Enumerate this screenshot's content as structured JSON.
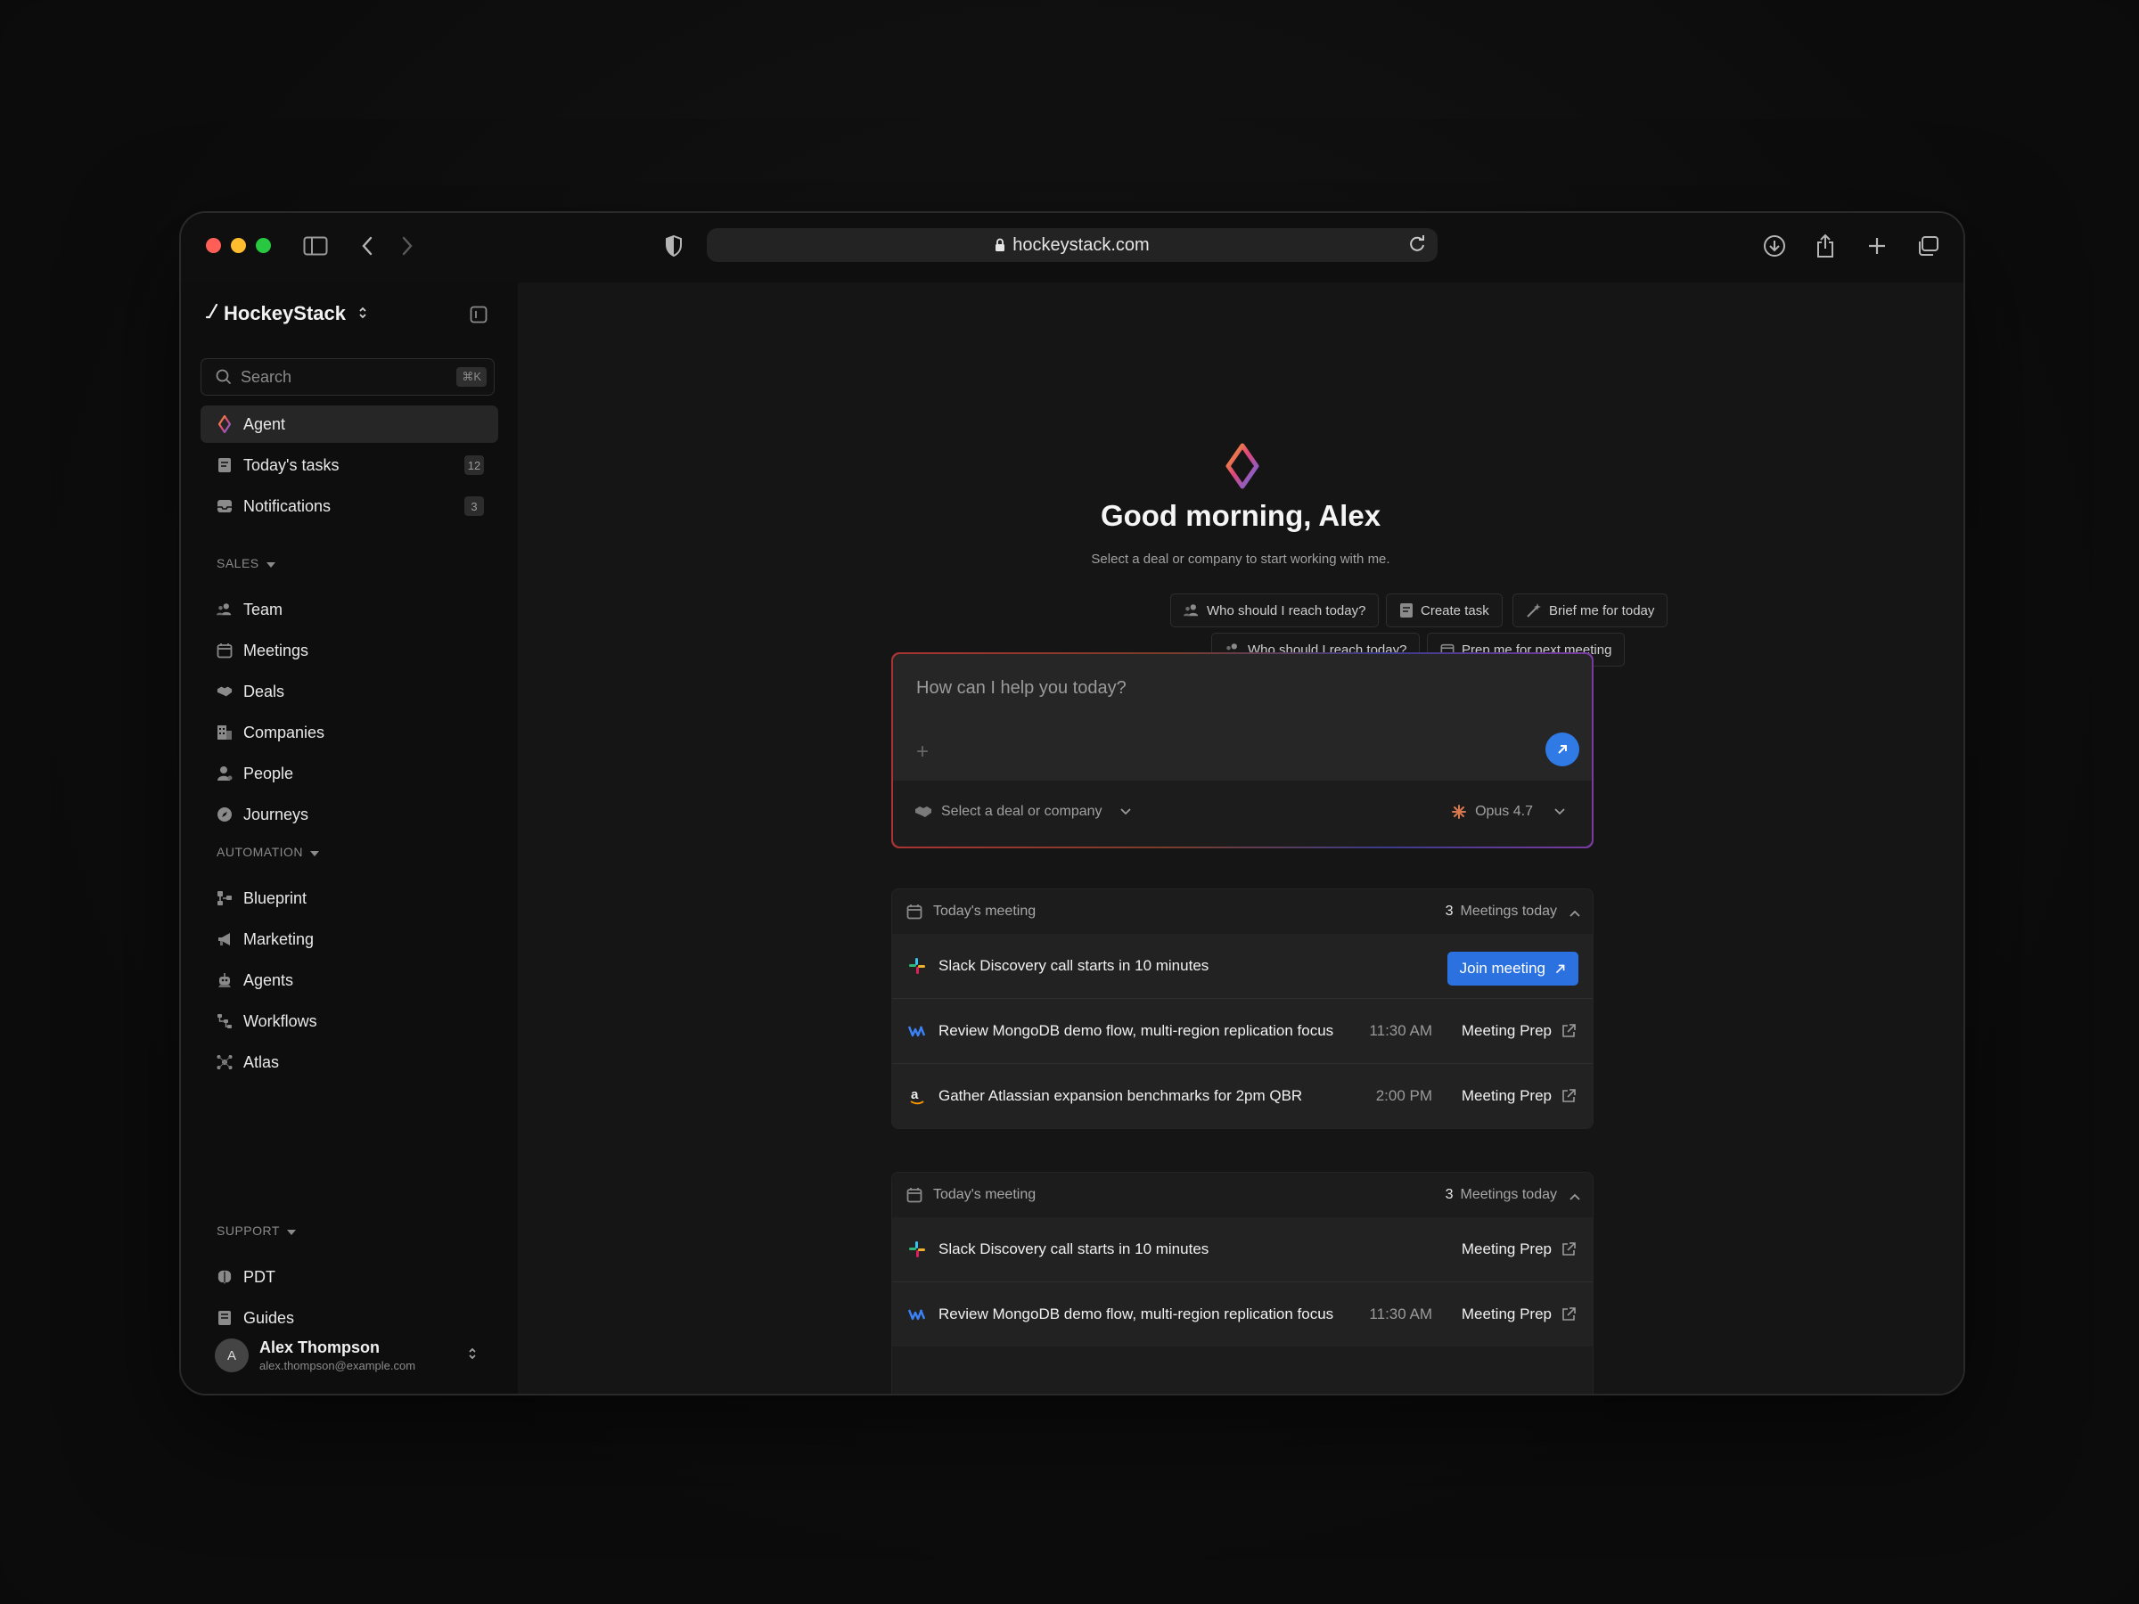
{
  "browser": {
    "url": "hockeystack.com"
  },
  "sidebar": {
    "brand": "HockeyStack",
    "search": {
      "placeholder": "Search",
      "shortcut": "⌘K"
    },
    "top_items": [
      {
        "label": "Agent",
        "icon": "agent-icon",
        "active": true
      },
      {
        "label": "Today's tasks",
        "icon": "tasks-icon",
        "badge": "12"
      },
      {
        "label": "Notifications",
        "icon": "inbox-icon",
        "badge": "3"
      }
    ],
    "sales": {
      "title": "SALES",
      "items": [
        {
          "label": "Team",
          "icon": "team-icon"
        },
        {
          "label": "Meetings",
          "icon": "calendar-icon"
        },
        {
          "label": "Deals",
          "icon": "handshake-icon"
        },
        {
          "label": "Companies",
          "icon": "building-icon"
        },
        {
          "label": "People",
          "icon": "person-icon"
        },
        {
          "label": "Journeys",
          "icon": "compass-icon"
        }
      ]
    },
    "automation": {
      "title": "AUTOMATION",
      "items": [
        {
          "label": "Blueprint",
          "icon": "blueprint-icon"
        },
        {
          "label": "Marketing",
          "icon": "megaphone-icon"
        },
        {
          "label": "Agents",
          "icon": "robot-icon"
        },
        {
          "label": "Workflows",
          "icon": "workflow-icon"
        },
        {
          "label": "Atlas",
          "icon": "atlas-icon"
        }
      ]
    },
    "support": {
      "title": "SUPPORT",
      "items": [
        {
          "label": "PDT",
          "icon": "brain-icon"
        },
        {
          "label": "Guides",
          "icon": "book-icon"
        }
      ]
    },
    "user": {
      "initial": "A",
      "name": "Alex Thompson",
      "email": "alex.thompson@example.com"
    }
  },
  "main": {
    "greeting": "Good morning, Alex",
    "subtitle": "Select a deal or company to start working with me.",
    "suggestions_row1": [
      "Who should I reach today?",
      "Create task",
      "Brief me for today"
    ],
    "suggestions_row2": [
      "Who should I reach today?",
      "Prep me for next meeting"
    ],
    "composer": {
      "placeholder": "How can I help you today?",
      "deal_select": "Select a deal or company",
      "model": "Opus 4.7"
    },
    "cards": [
      {
        "title": "Today's meeting",
        "count": "3",
        "count_label": "Meetings today",
        "rows": [
          {
            "logo": "slack-icon",
            "text": "Slack Discovery call starts in 10 minutes",
            "time": "",
            "action": "Join meeting"
          },
          {
            "logo": "mongodb-icon",
            "text": "Review MongoDB demo flow, multi-region replication focus",
            "time": "11:30 AM",
            "action": "Meeting Prep"
          },
          {
            "logo": "amazon-icon",
            "text": "Gather Atlassian expansion benchmarks for 2pm QBR",
            "time": "2:00 PM",
            "action": "Meeting Prep"
          }
        ]
      },
      {
        "title": "Today's meeting",
        "count": "3",
        "count_label": "Meetings today",
        "rows": [
          {
            "logo": "slack-icon",
            "text": "Slack Discovery call starts in 10 minutes",
            "time": "",
            "action": "Meeting Prep"
          },
          {
            "logo": "mongodb-icon",
            "text": "Review MongoDB demo flow, multi-region replication focus",
            "time": "11:30 AM",
            "action": "Meeting Prep"
          }
        ]
      }
    ]
  },
  "colors": {
    "accent": "#2f7ae5",
    "background": "#151515",
    "sidebar": "#0e0e0e"
  }
}
